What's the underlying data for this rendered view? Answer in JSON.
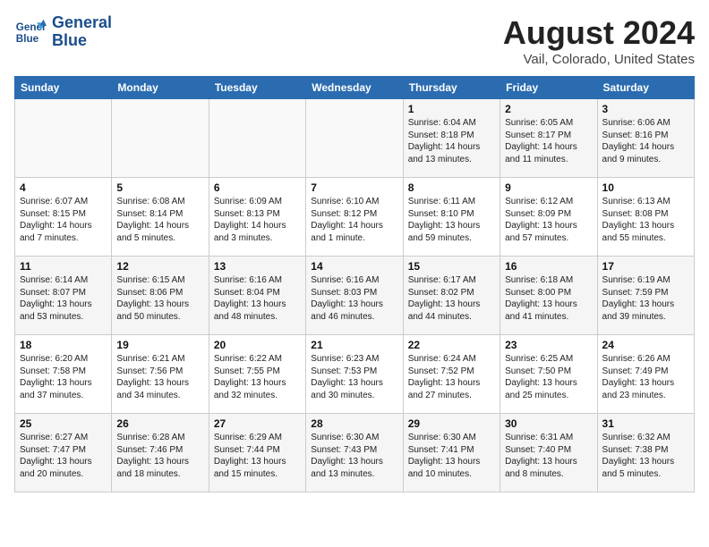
{
  "header": {
    "logo_line1": "General",
    "logo_line2": "Blue",
    "main_title": "August 2024",
    "subtitle": "Vail, Colorado, United States"
  },
  "weekdays": [
    "Sunday",
    "Monday",
    "Tuesday",
    "Wednesday",
    "Thursday",
    "Friday",
    "Saturday"
  ],
  "weeks": [
    [
      {
        "day": "",
        "info": ""
      },
      {
        "day": "",
        "info": ""
      },
      {
        "day": "",
        "info": ""
      },
      {
        "day": "",
        "info": ""
      },
      {
        "day": "1",
        "info": "Sunrise: 6:04 AM\nSunset: 8:18 PM\nDaylight: 14 hours\nand 13 minutes."
      },
      {
        "day": "2",
        "info": "Sunrise: 6:05 AM\nSunset: 8:17 PM\nDaylight: 14 hours\nand 11 minutes."
      },
      {
        "day": "3",
        "info": "Sunrise: 6:06 AM\nSunset: 8:16 PM\nDaylight: 14 hours\nand 9 minutes."
      }
    ],
    [
      {
        "day": "4",
        "info": "Sunrise: 6:07 AM\nSunset: 8:15 PM\nDaylight: 14 hours\nand 7 minutes."
      },
      {
        "day": "5",
        "info": "Sunrise: 6:08 AM\nSunset: 8:14 PM\nDaylight: 14 hours\nand 5 minutes."
      },
      {
        "day": "6",
        "info": "Sunrise: 6:09 AM\nSunset: 8:13 PM\nDaylight: 14 hours\nand 3 minutes."
      },
      {
        "day": "7",
        "info": "Sunrise: 6:10 AM\nSunset: 8:12 PM\nDaylight: 14 hours\nand 1 minute."
      },
      {
        "day": "8",
        "info": "Sunrise: 6:11 AM\nSunset: 8:10 PM\nDaylight: 13 hours\nand 59 minutes."
      },
      {
        "day": "9",
        "info": "Sunrise: 6:12 AM\nSunset: 8:09 PM\nDaylight: 13 hours\nand 57 minutes."
      },
      {
        "day": "10",
        "info": "Sunrise: 6:13 AM\nSunset: 8:08 PM\nDaylight: 13 hours\nand 55 minutes."
      }
    ],
    [
      {
        "day": "11",
        "info": "Sunrise: 6:14 AM\nSunset: 8:07 PM\nDaylight: 13 hours\nand 53 minutes."
      },
      {
        "day": "12",
        "info": "Sunrise: 6:15 AM\nSunset: 8:06 PM\nDaylight: 13 hours\nand 50 minutes."
      },
      {
        "day": "13",
        "info": "Sunrise: 6:16 AM\nSunset: 8:04 PM\nDaylight: 13 hours\nand 48 minutes."
      },
      {
        "day": "14",
        "info": "Sunrise: 6:16 AM\nSunset: 8:03 PM\nDaylight: 13 hours\nand 46 minutes."
      },
      {
        "day": "15",
        "info": "Sunrise: 6:17 AM\nSunset: 8:02 PM\nDaylight: 13 hours\nand 44 minutes."
      },
      {
        "day": "16",
        "info": "Sunrise: 6:18 AM\nSunset: 8:00 PM\nDaylight: 13 hours\nand 41 minutes."
      },
      {
        "day": "17",
        "info": "Sunrise: 6:19 AM\nSunset: 7:59 PM\nDaylight: 13 hours\nand 39 minutes."
      }
    ],
    [
      {
        "day": "18",
        "info": "Sunrise: 6:20 AM\nSunset: 7:58 PM\nDaylight: 13 hours\nand 37 minutes."
      },
      {
        "day": "19",
        "info": "Sunrise: 6:21 AM\nSunset: 7:56 PM\nDaylight: 13 hours\nand 34 minutes."
      },
      {
        "day": "20",
        "info": "Sunrise: 6:22 AM\nSunset: 7:55 PM\nDaylight: 13 hours\nand 32 minutes."
      },
      {
        "day": "21",
        "info": "Sunrise: 6:23 AM\nSunset: 7:53 PM\nDaylight: 13 hours\nand 30 minutes."
      },
      {
        "day": "22",
        "info": "Sunrise: 6:24 AM\nSunset: 7:52 PM\nDaylight: 13 hours\nand 27 minutes."
      },
      {
        "day": "23",
        "info": "Sunrise: 6:25 AM\nSunset: 7:50 PM\nDaylight: 13 hours\nand 25 minutes."
      },
      {
        "day": "24",
        "info": "Sunrise: 6:26 AM\nSunset: 7:49 PM\nDaylight: 13 hours\nand 23 minutes."
      }
    ],
    [
      {
        "day": "25",
        "info": "Sunrise: 6:27 AM\nSunset: 7:47 PM\nDaylight: 13 hours\nand 20 minutes."
      },
      {
        "day": "26",
        "info": "Sunrise: 6:28 AM\nSunset: 7:46 PM\nDaylight: 13 hours\nand 18 minutes."
      },
      {
        "day": "27",
        "info": "Sunrise: 6:29 AM\nSunset: 7:44 PM\nDaylight: 13 hours\nand 15 minutes."
      },
      {
        "day": "28",
        "info": "Sunrise: 6:30 AM\nSunset: 7:43 PM\nDaylight: 13 hours\nand 13 minutes."
      },
      {
        "day": "29",
        "info": "Sunrise: 6:30 AM\nSunset: 7:41 PM\nDaylight: 13 hours\nand 10 minutes."
      },
      {
        "day": "30",
        "info": "Sunrise: 6:31 AM\nSunset: 7:40 PM\nDaylight: 13 hours\nand 8 minutes."
      },
      {
        "day": "31",
        "info": "Sunrise: 6:32 AM\nSunset: 7:38 PM\nDaylight: 13 hours\nand 5 minutes."
      }
    ]
  ]
}
